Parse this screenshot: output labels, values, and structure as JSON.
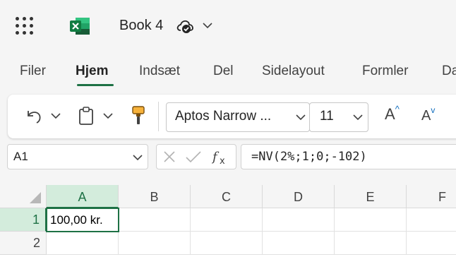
{
  "app": {
    "doc_title": "Book 4",
    "icons": {
      "app_launcher": "waffle-icon",
      "app": "excel-icon",
      "save_status": "cloud-saved-icon",
      "title_menu": "chevron-down-icon"
    },
    "brand_color": "#1e7145"
  },
  "tabs": [
    {
      "label": "Filer"
    },
    {
      "label": "Hjem",
      "active": true
    },
    {
      "label": "Indsæt"
    },
    {
      "label": "Del"
    },
    {
      "label": "Sidelayout"
    },
    {
      "label": "Formler"
    },
    {
      "label": "Da"
    }
  ],
  "ribbon": {
    "font_name": "Aptos Narrow ...",
    "font_size": "11",
    "grow_font_label": "A",
    "shrink_font_label": "A",
    "icons": [
      "undo-icon",
      "clipboard-icon",
      "format-painter-icon",
      "increase-font-icon",
      "decrease-font-icon"
    ]
  },
  "formula_bar": {
    "name_box": "A1",
    "formula": "=NV(2%;1;0;-102)",
    "icons": [
      "cancel-icon",
      "enter-icon",
      "insert-function-icon"
    ]
  },
  "sheet": {
    "columns": [
      "A",
      "B",
      "C",
      "D",
      "E",
      "F"
    ],
    "rows": [
      "1",
      "2"
    ],
    "selected_cell": "A1",
    "cells": {
      "A1": "100,00 kr."
    }
  }
}
